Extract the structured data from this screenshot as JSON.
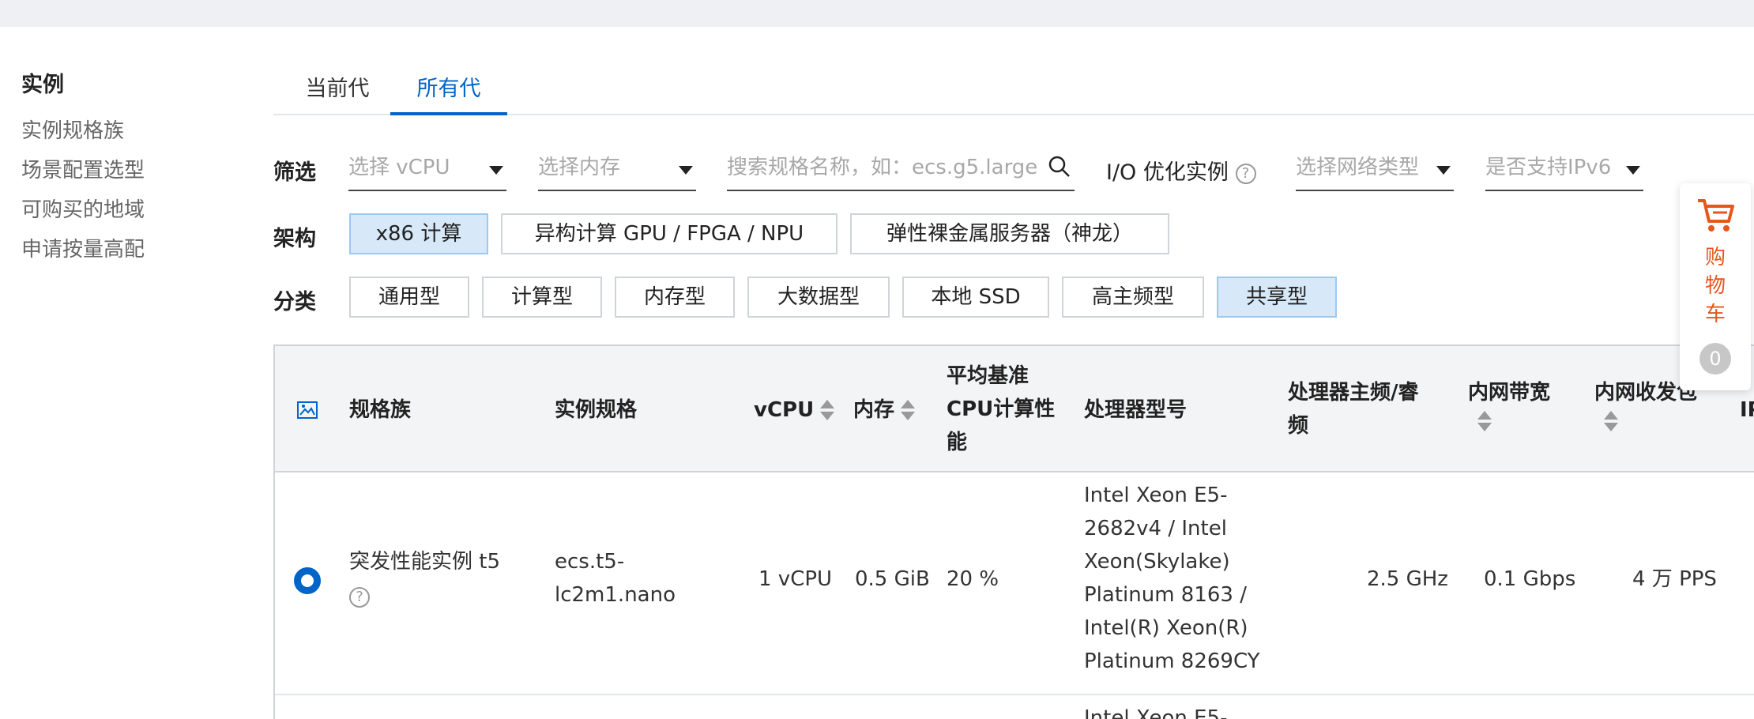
{
  "sidebar": {
    "title": "实例",
    "items": [
      "实例规格族",
      "场景配置选型",
      "可购买的地域",
      "申请按量高配"
    ]
  },
  "tabs": [
    "当前代",
    "所有代"
  ],
  "filter": {
    "label": "筛选",
    "vcpu_placeholder": "选择 vCPU",
    "memory_placeholder": "选择内存",
    "search_placeholder": "搜索规格名称，如：ecs.g5.large",
    "io_label": "I/O 优化实例",
    "network_placeholder": "选择网络类型",
    "ipv6_placeholder": "是否支持IPv6"
  },
  "arch": {
    "label": "架构",
    "options": [
      "x86 计算",
      "异构计算 GPU / FPGA / NPU",
      "弹性裸金属服务器（神龙）"
    ],
    "selected": "x86 计算"
  },
  "category": {
    "label": "分类",
    "options": [
      "通用型",
      "计算型",
      "内存型",
      "大数据型",
      "本地 SSD",
      "高主频型",
      "共享型"
    ],
    "selected": "共享型"
  },
  "table": {
    "headers": {
      "family": "规格族",
      "spec": "实例规格",
      "vcpu": "vCPU",
      "memory": "内存",
      "baseline_l1": "平均基准",
      "baseline_l2": "CPU计算性",
      "baseline_l3": "能",
      "processor": "处理器型号",
      "freq_l1": "处理器主频/睿",
      "freq_l2": "频",
      "bandwidth": "内网带宽",
      "pps": "内网收发包",
      "ip": "IP"
    },
    "rows": [
      {
        "family": "突发性能实例 t5",
        "spec_l1": "ecs.t5-",
        "spec_l2": "lc2m1.nano",
        "vcpu": "1 vCPU",
        "memory": "0.5 GiB",
        "baseline": "20 %",
        "processor_lines": [
          "Intel Xeon E5-",
          "2682v4 / Intel",
          "Xeon(Skylake)",
          "Platinum 8163 /",
          "Intel(R) Xeon(R)",
          "Platinum 8269CY"
        ],
        "freq": "2.5 GHz",
        "bandwidth": "0.1 Gbps",
        "pps": "4 万 PPS"
      }
    ],
    "next_row_partial": "Intel Xeon E5-"
  },
  "cart": {
    "label_chars": [
      "购",
      "物",
      "车"
    ],
    "count": "0",
    "accent": "#e5571c"
  },
  "colors": {
    "primary": "#0064c8",
    "selected_chip_bg": "#d7e8f8"
  }
}
